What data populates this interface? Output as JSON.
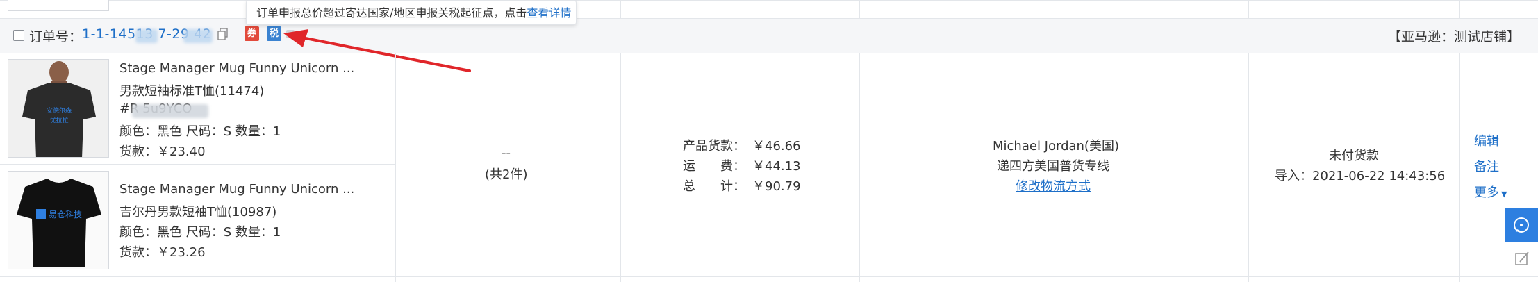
{
  "tooltip": {
    "text": "订单申报总价超过寄达国家/地区申报关税起征点，点击",
    "link": "查看详情"
  },
  "order": {
    "label": "订单号：",
    "number": "1-1-14513  7-29  42",
    "badge_coupon": "券",
    "badge_tax": "税",
    "store": "【亚马逊：测试店铺】"
  },
  "products": [
    {
      "title": "Stage Manager Mug Funny Unicorn ...",
      "variant": "男款短袖标准T恤(11474)",
      "sku": "#R           5u9YCO",
      "attrs": "颜色：黑色    尺码：S   数量：1",
      "price": "货款：￥23.40",
      "shirt_color": "#2b2b2b",
      "print_text": "安德尔森\n优拉拉"
    },
    {
      "title": "Stage Manager Mug Funny Unicorn ...",
      "variant": "吉尔丹男款短袖T恤(10987)",
      "attrs": "颜色：黑色    尺码：S   数量：1",
      "price": "货款：￥23.26",
      "shirt_color": "#111111",
      "print_text": "易仓科技"
    }
  ],
  "quantity": {
    "dash": "--",
    "total": "(共2件)"
  },
  "fees": {
    "product_label": "产品货款：",
    "product_value": "￥46.66",
    "shipping_label": "运　　费：",
    "shipping_value": "￥44.13",
    "total_label": "总　　计：",
    "total_value": "￥90.79"
  },
  "recipient": {
    "name": "Michael Jordan(美国)",
    "shipping_method": "递四方美国普货专线",
    "change_link": "修改物流方式"
  },
  "status": {
    "payment": "未付货款",
    "import_time": "导入：2021-06-22 14:43:56"
  },
  "actions": {
    "edit": "编辑",
    "note": "备注",
    "more": "更多"
  },
  "colors": {
    "link": "#1e6fc8",
    "arrow": "#e0262a",
    "side_button": "#2d7fe0"
  }
}
